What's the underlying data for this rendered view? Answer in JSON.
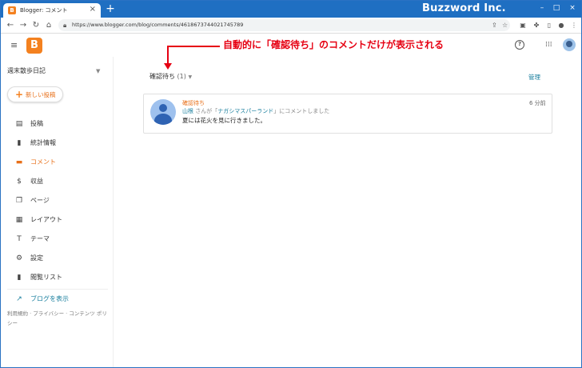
{
  "browser": {
    "tab_title": "Blogger: コメント",
    "tab_favicon": "B",
    "tab_close": "×",
    "new_tab": "+",
    "brand": "Buzzword Inc.",
    "url": "https://www.blogger.com/blog/comments/4618673744021745789",
    "window_buttons": [
      "–",
      "□",
      "×"
    ]
  },
  "header": {
    "menu_icon": "≡",
    "logo_letter": "B",
    "help_icon": "?",
    "apps_icon": "⋮⋮⋮"
  },
  "annotation": {
    "text": "自動的に「確認待ち」のコメントだけが表示される",
    "color": "#e60012"
  },
  "sidebar": {
    "blog_name": "週末散歩日記",
    "caret": "▼",
    "new_post": "新しい投稿",
    "items": [
      {
        "label": "投稿",
        "icon": "▤",
        "active": false
      },
      {
        "label": "統計情報",
        "icon": "▮",
        "active": false
      },
      {
        "label": "コメント",
        "icon": "▬",
        "active": true
      },
      {
        "label": "収益",
        "icon": "$",
        "active": false
      },
      {
        "label": "ページ",
        "icon": "❐",
        "active": false
      },
      {
        "label": "レイアウト",
        "icon": "▦",
        "active": false
      },
      {
        "label": "テーマ",
        "icon": "T",
        "active": false
      },
      {
        "label": "設定",
        "icon": "⚙",
        "active": false
      },
      {
        "label": "閲覧リスト",
        "icon": "▮",
        "active": false
      }
    ],
    "view_blog": "ブログを表示",
    "footer": "利用規約 · プライバシー · コンテンツ ポリシー"
  },
  "main": {
    "filter_label": "確認待ち",
    "filter_count": "(1)",
    "manage": "管理",
    "comment": {
      "status": "確認待ち",
      "author": "山根",
      "meta_mid": " さんが「",
      "post_title": "ナガシマスパーランド",
      "meta_end": "」にコメントしました",
      "text": "夏には花火を見に行きました。",
      "time": "6 分前"
    }
  },
  "colors": {
    "accent": "#e8701a",
    "link": "#1a7f9e",
    "titlebar": "#1f6fc2"
  }
}
